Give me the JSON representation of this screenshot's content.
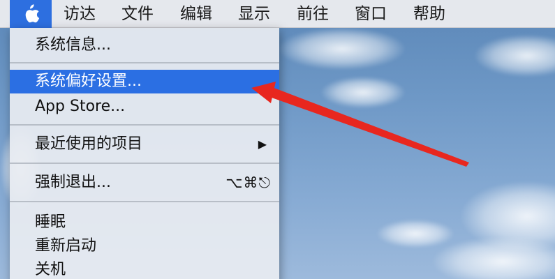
{
  "menubar": {
    "items": [
      "访达",
      "文件",
      "编辑",
      "显示",
      "前往",
      "窗口",
      "帮助"
    ]
  },
  "apple_menu": {
    "items": [
      {
        "label": "系统信息..."
      },
      {
        "label": "系统偏好设置...",
        "selected": true
      },
      {
        "label": "App Store..."
      },
      {
        "label": "最近使用的项目",
        "submenu_glyph": "▶"
      },
      {
        "label": "强制退出...",
        "shortcut": "⌥⌘⎋"
      },
      {
        "label": "睡眠"
      },
      {
        "label": "重新启动"
      },
      {
        "label": "关机"
      }
    ]
  },
  "colors": {
    "highlight": "#2b6fe3",
    "arrow": "#e8271f",
    "desktop": "#6e98c6"
  },
  "icons": {
    "apple_menu_icon": "apple-logo-icon",
    "submenu_icon": "submenu-triangle-icon"
  }
}
